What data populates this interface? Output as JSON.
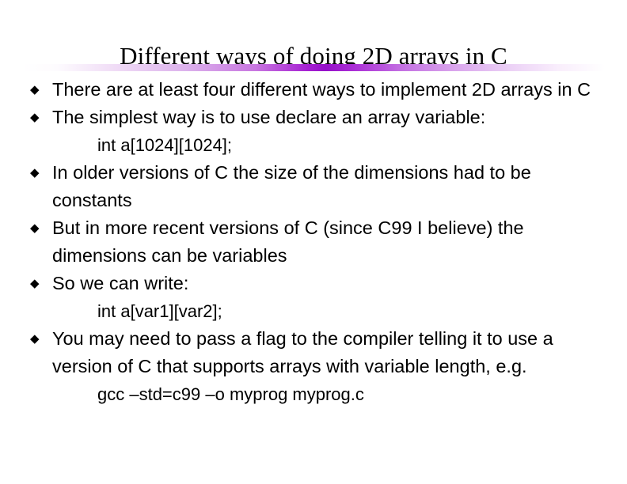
{
  "slide": {
    "title": "Different ways of doing 2D arrays in C",
    "divider": {
      "accent_color": "#9510c9",
      "edge_color": "#ffffff"
    },
    "bullet_glyph": "◆",
    "text_color": "#000000",
    "background_color": "#ffffff",
    "bullets": [
      {
        "text": "There are at least four different ways to implement 2D arrays in C",
        "code": null
      },
      {
        "text": "The simplest way is to use declare an array variable:",
        "code": "int a[1024][1024];"
      },
      {
        "text": "In older versions of C the size of the dimensions had to be constants",
        "code": null
      },
      {
        "text": "But in more recent versions of C (since C99 I believe) the dimensions can be variables",
        "code": null
      },
      {
        "text": "So we can write:",
        "code": "int a[var1][var2];"
      },
      {
        "text": "You may need to pass a flag to the compiler telling it to use a version of C that supports arrays with variable length, e.g.",
        "code": "gcc –std=c99 –o myprog myprog.c"
      }
    ]
  }
}
